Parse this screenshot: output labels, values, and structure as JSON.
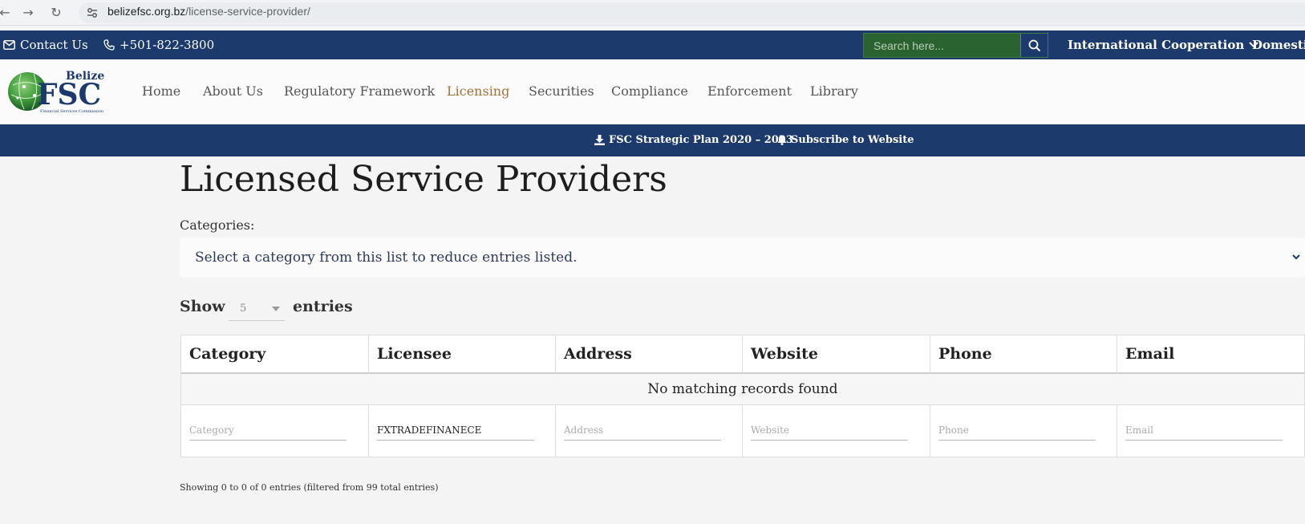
{
  "browser": {
    "url_host": "belizefsc.org.bz",
    "url_path": "/license-service-provider/"
  },
  "topbar": {
    "contact_label": "Contact Us",
    "phone_label": "+501-822-3800",
    "search_placeholder": "Search here...",
    "menu_international": "International Cooperation",
    "menu_domestic": "Domestic"
  },
  "logo": {
    "word_top": "Belize",
    "word_main": "FSC",
    "word_sub": "Financial Services Commission"
  },
  "nav": {
    "home": "Home",
    "about": "About Us",
    "regulatory": "Regulatory Framework",
    "licensing": "Licensing",
    "securities": "Securities",
    "compliance": "Compliance",
    "enforcement": "Enforcement",
    "library": "Library"
  },
  "subbar": {
    "strategic_plan": "FSC Strategic Plan 2020 – 2023",
    "subscribe": "Subscribe to Website"
  },
  "page": {
    "title": "Licensed Service Providers",
    "categories_label": "Categories:",
    "categories_select_text": "Select a category from this list to reduce entries listed.",
    "show_label": "Show",
    "entries_value": "5",
    "entries_label": "entries"
  },
  "table": {
    "headers": {
      "category": "Category",
      "licensee": "Licensee",
      "address": "Address",
      "website": "Website",
      "phone": "Phone",
      "email": "Email"
    },
    "empty_message": "No matching records found",
    "filters": {
      "category_placeholder": "Category",
      "licensee_value": "FXTRADEFINANECE",
      "address_placeholder": "Address",
      "website_placeholder": "Website",
      "phone_placeholder": "Phone",
      "email_placeholder": "Email"
    }
  },
  "info_text": "Showing 0 to 0 of 0 entries (filtered from 99 total entries)",
  "colors": {
    "navy": "#1c3a6b",
    "search_green": "#2b6330",
    "active_nav": "#a0733a"
  }
}
